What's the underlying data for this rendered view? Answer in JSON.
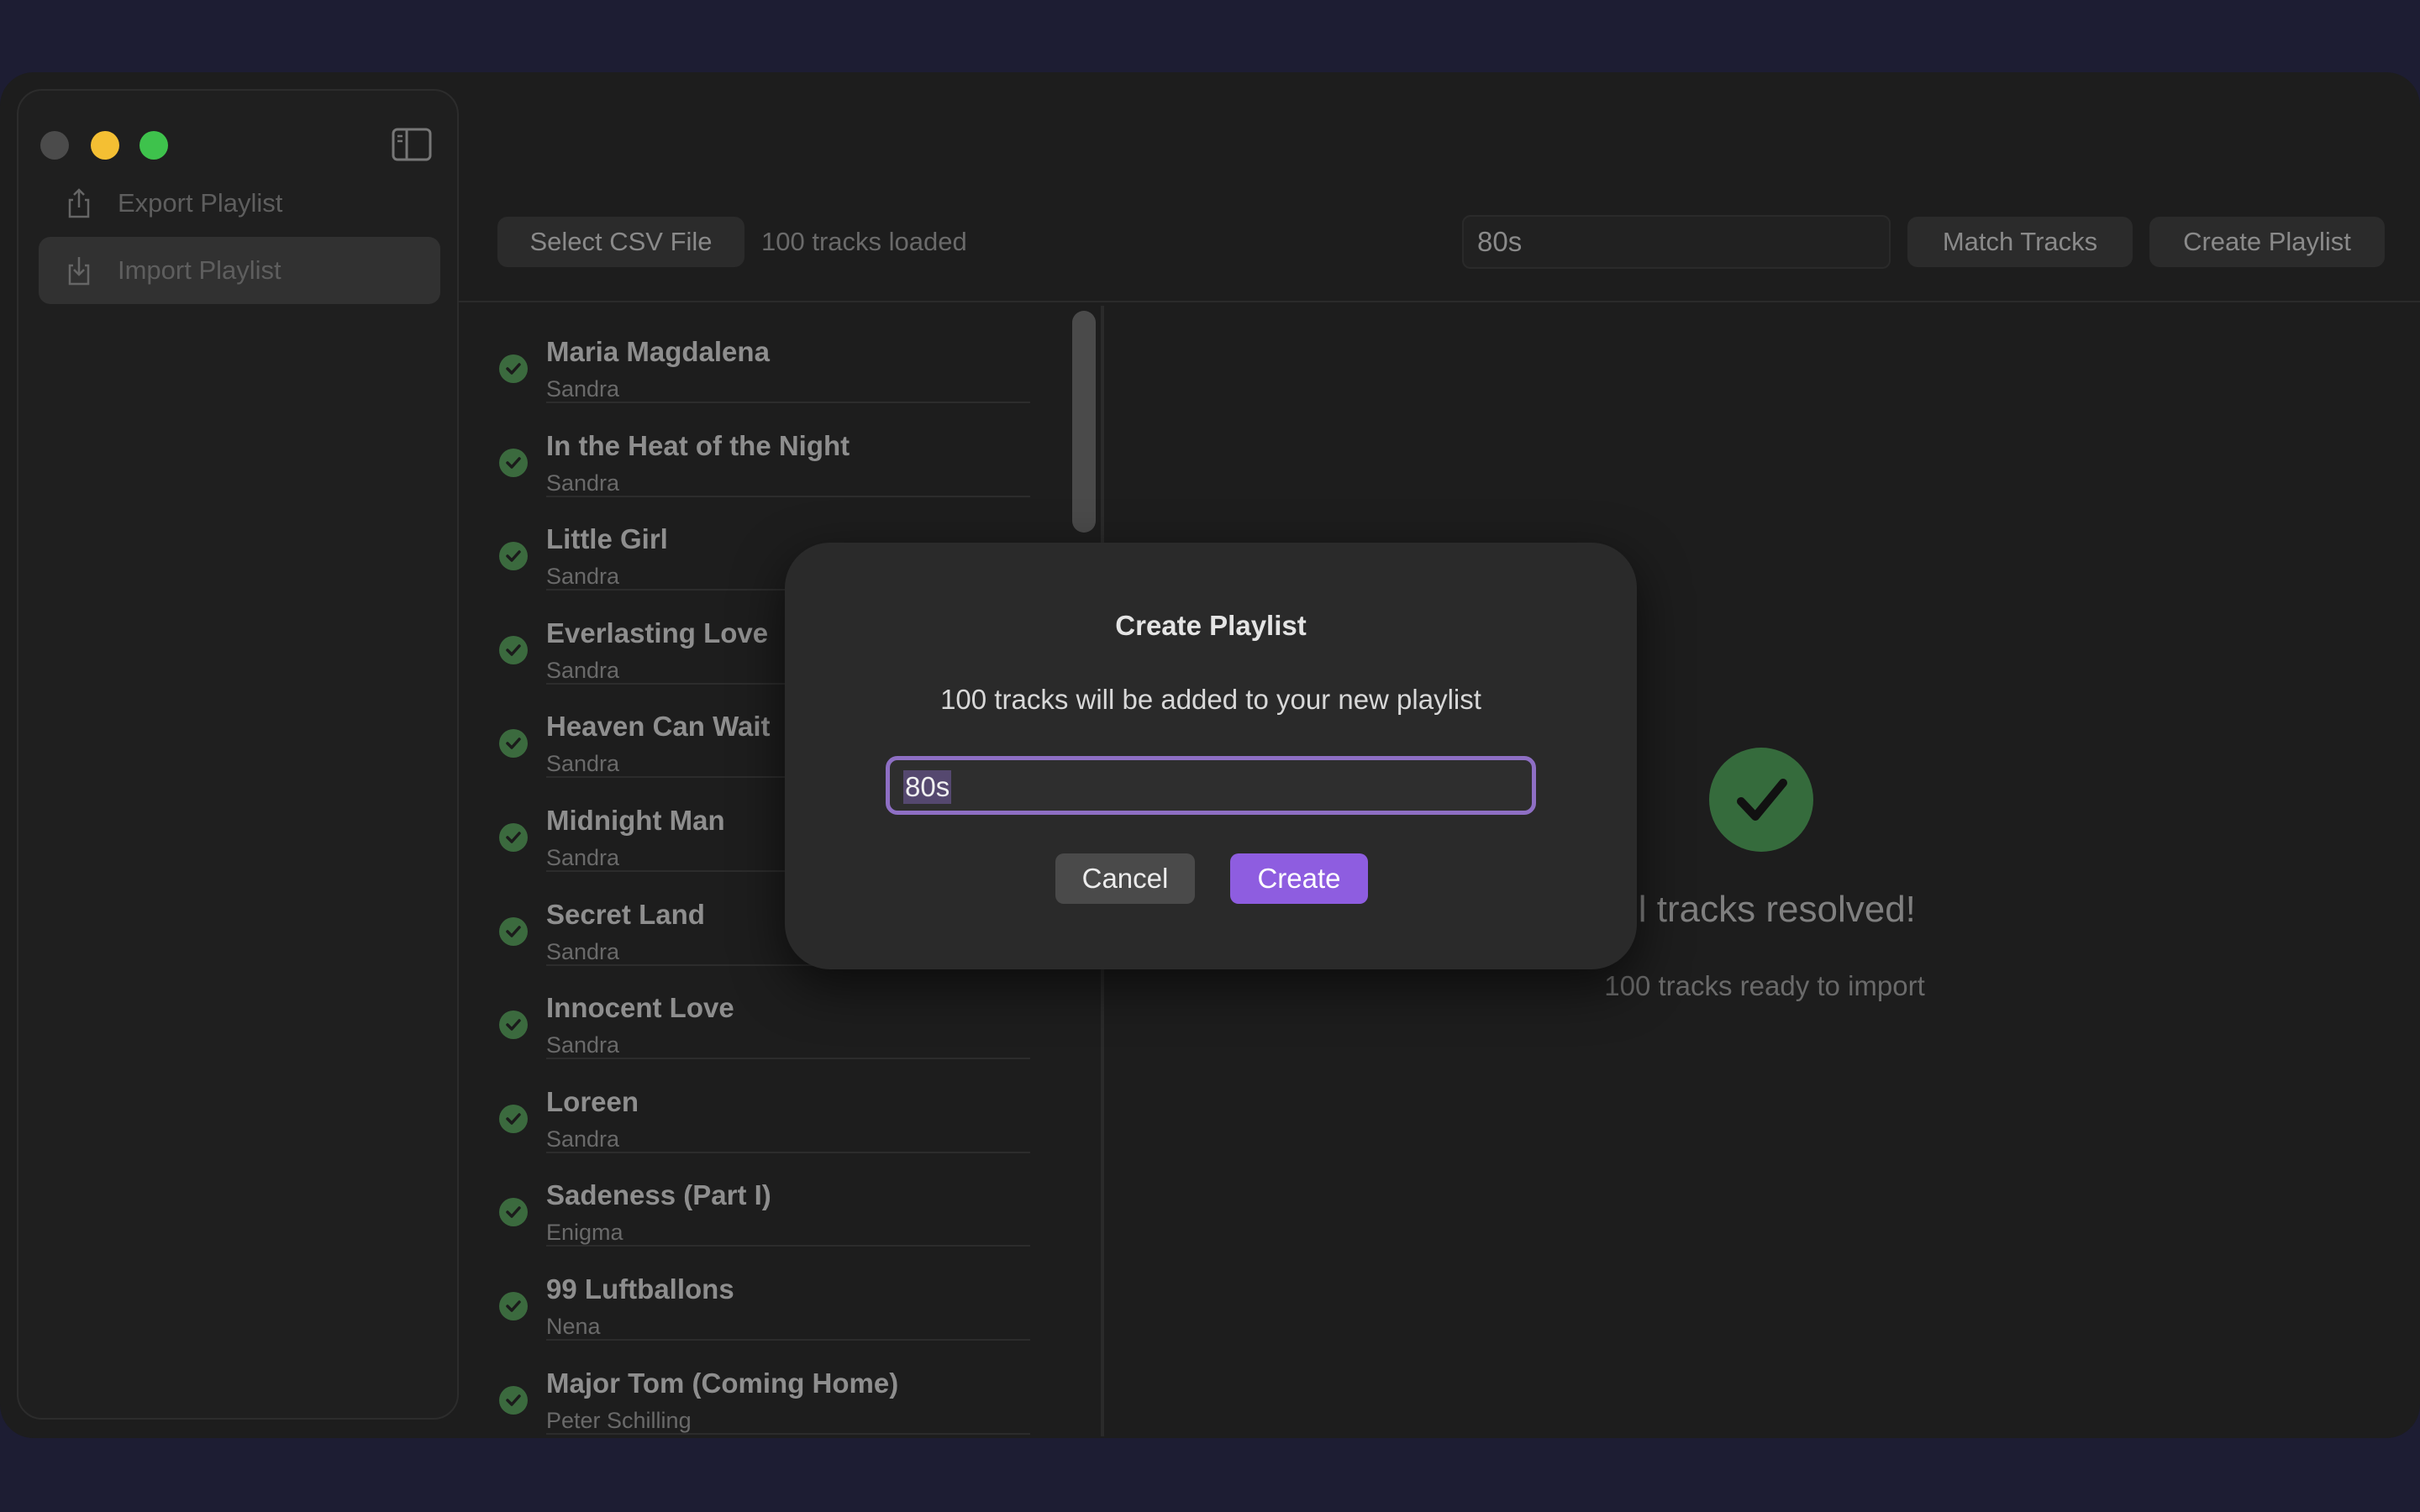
{
  "sidebar": {
    "items": [
      {
        "label": "Export Playlist",
        "icon": "share-icon"
      },
      {
        "label": "Import Playlist",
        "icon": "download-tray-icon",
        "selected": true
      }
    ]
  },
  "toolbar": {
    "select_csv_label": "Select CSV File",
    "status": "100 tracks loaded",
    "playlist_name_value": "80s",
    "match_tracks_label": "Match Tracks",
    "create_playlist_label": "Create Playlist"
  },
  "tracks": [
    {
      "title": "Maria Magdalena",
      "artist": "Sandra"
    },
    {
      "title": "In the Heat of the Night",
      "artist": "Sandra"
    },
    {
      "title": "Little Girl",
      "artist": "Sandra"
    },
    {
      "title": "Everlasting Love",
      "artist": "Sandra"
    },
    {
      "title": "Heaven Can Wait",
      "artist": "Sandra"
    },
    {
      "title": "Midnight Man",
      "artist": "Sandra"
    },
    {
      "title": "Secret Land",
      "artist": "Sandra"
    },
    {
      "title": "Innocent Love",
      "artist": "Sandra"
    },
    {
      "title": "Loreen",
      "artist": "Sandra"
    },
    {
      "title": "Sadeness (Part I)",
      "artist": "Enigma"
    },
    {
      "title": "99 Luftballons",
      "artist": "Nena"
    },
    {
      "title": "Major Tom (Coming Home)",
      "artist": "Peter Schilling"
    }
  ],
  "result": {
    "title": "All tracks resolved!",
    "visible_title": "ll tracks resolved!",
    "subtitle": "100 tracks ready to import"
  },
  "dialog": {
    "title": "Create Playlist",
    "message": "100 tracks will be added to your new playlist",
    "input_value": "80s",
    "cancel_label": "Cancel",
    "create_label": "Create"
  },
  "colors": {
    "accent": "#8e5de0",
    "success": "#3b6a3e",
    "window_bg": "#1d1d1d",
    "desktop_bg": "#1d1d33"
  }
}
